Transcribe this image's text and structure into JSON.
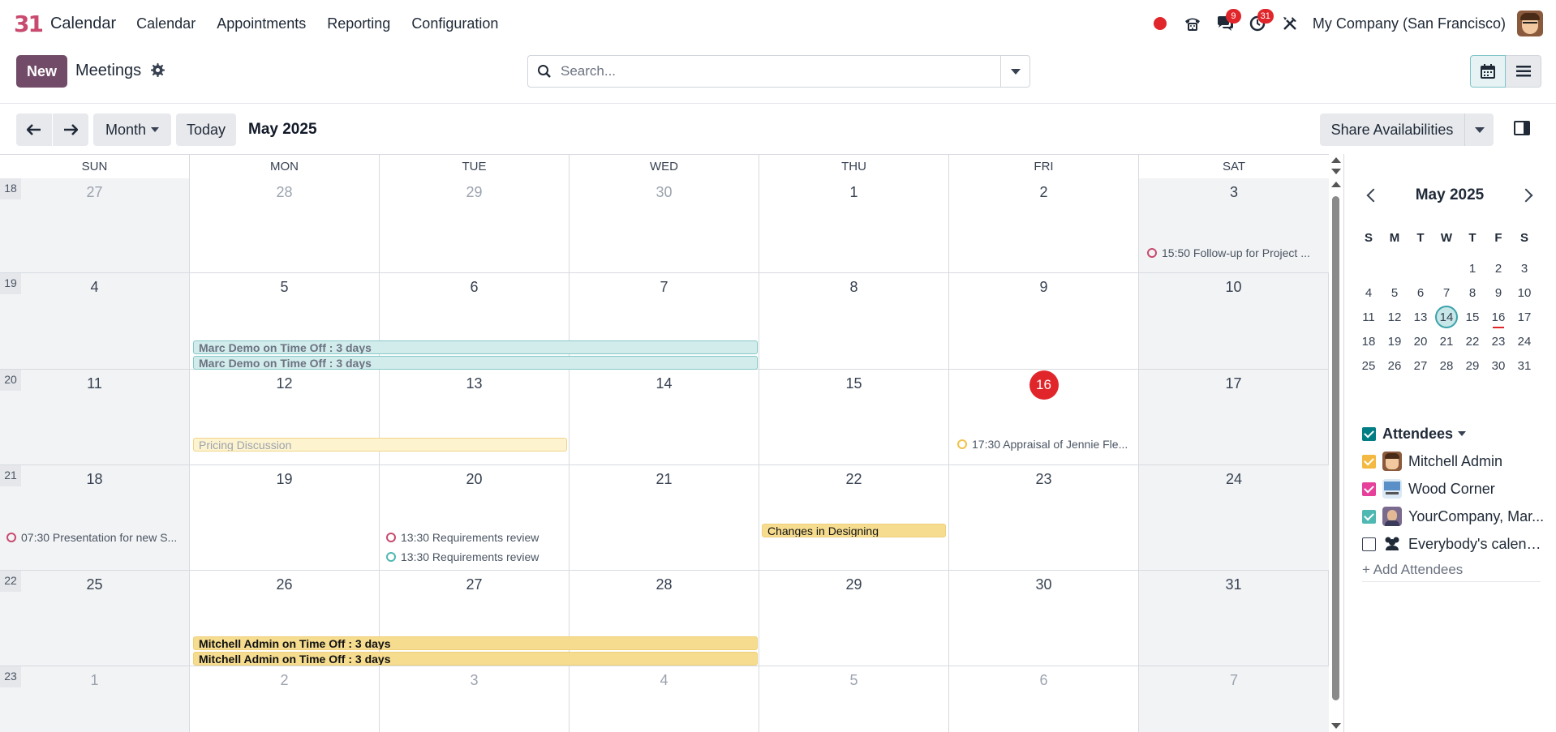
{
  "app": {
    "logo_text": "31",
    "name": "Calendar",
    "menu": [
      "Calendar",
      "Appointments",
      "Reporting",
      "Configuration"
    ]
  },
  "systray": {
    "messages_count": "9",
    "activities_count": "31",
    "company": "My Company (San Francisco)"
  },
  "control_panel": {
    "new_label": "New",
    "title": "Meetings",
    "search_placeholder": "Search..."
  },
  "toolbar": {
    "scale_label": "Month",
    "today_label": "Today",
    "period": "May 2025",
    "share_label": "Share Availabilities"
  },
  "calendar": {
    "day_headers": [
      "SUN",
      "MON",
      "TUE",
      "WED",
      "THU",
      "FRI",
      "SAT"
    ],
    "weeks": [
      {
        "num": "18",
        "days": [
          "27",
          "28",
          "29",
          "30",
          "1",
          "2",
          "3"
        ]
      },
      {
        "num": "19",
        "days": [
          "4",
          "5",
          "6",
          "7",
          "8",
          "9",
          "10"
        ]
      },
      {
        "num": "20",
        "days": [
          "11",
          "12",
          "13",
          "14",
          "15",
          "16",
          "17"
        ]
      },
      {
        "num": "21",
        "days": [
          "18",
          "19",
          "20",
          "21",
          "22",
          "23",
          "24"
        ]
      },
      {
        "num": "22",
        "days": [
          "25",
          "26",
          "27",
          "28",
          "29",
          "30",
          "31"
        ]
      },
      {
        "num": "23",
        "days": [
          "1",
          "2",
          "3",
          "4",
          "5",
          "6",
          "7"
        ]
      }
    ],
    "events": {
      "followup": "15:50 Follow-up for Project ...",
      "marc_timeoff_1": "Marc Demo on Time Off : 3 days",
      "marc_timeoff_2": "Marc Demo on Time Off : 3 days",
      "pricing": "Pricing Discussion",
      "appraisal": "17:30 Appraisal of Jennie Fle...",
      "presentation": "07:30 Presentation for new S...",
      "requirements_1": "13:30 Requirements review",
      "requirements_2": "13:30 Requirements review",
      "designing": "Changes in Designing",
      "mitchell_timeoff_1": "Mitchell Admin on Time Off : 3 days",
      "mitchell_timeoff_2": "Mitchell Admin on Time Off : 3 days"
    }
  },
  "sidebar": {
    "mini_title": "May 2025",
    "mini_headers": [
      "S",
      "M",
      "T",
      "W",
      "T",
      "F",
      "S"
    ],
    "mini_weeks": [
      [
        "",
        "",
        "",
        "",
        "1",
        "2",
        "3"
      ],
      [
        "4",
        "5",
        "6",
        "7",
        "8",
        "9",
        "10"
      ],
      [
        "11",
        "12",
        "13",
        "14",
        "15",
        "16",
        "17"
      ],
      [
        "18",
        "19",
        "20",
        "21",
        "22",
        "23",
        "24"
      ],
      [
        "25",
        "26",
        "27",
        "28",
        "29",
        "30",
        "31"
      ]
    ],
    "attendees_title": "Attendees",
    "attendees": [
      {
        "name": "Mitchell Admin",
        "color": "#f4b942"
      },
      {
        "name": "Wood Corner",
        "color": "#e6409a"
      },
      {
        "name": "YourCompany, Mar...",
        "color": "#4fb8b2"
      },
      {
        "name": "Everybody's calend...",
        "color": ""
      }
    ],
    "add_attendees": "+ Add Attendees"
  },
  "colors": {
    "brand": "#714b67",
    "today": "#e0262b",
    "attendees_check": "#017e84"
  }
}
